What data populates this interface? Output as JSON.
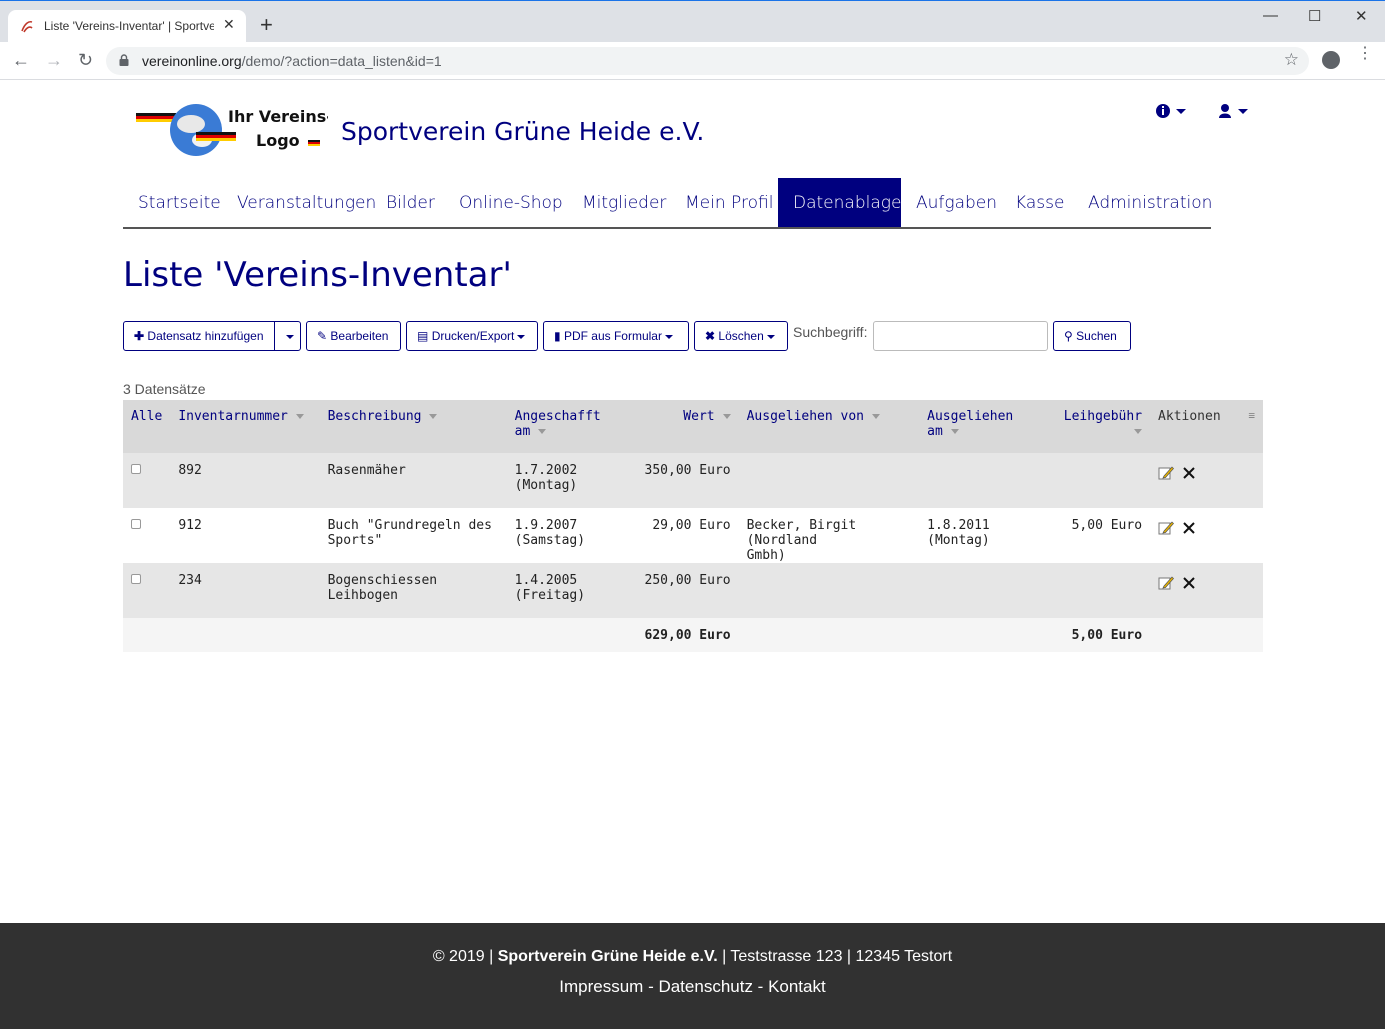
{
  "browser": {
    "tab_title": "Liste 'Vereins-Inventar' | Sportver",
    "new_tab": "+",
    "url_host": "vereinonline.org",
    "url_path": "/demo/?action=data_listen&id=1",
    "minimize": "—",
    "maximize": "☐",
    "close": "✕",
    "back": "←",
    "forward": "→",
    "reload": "↻",
    "bookmark": "☆",
    "menu": "⋮"
  },
  "header": {
    "logo_text_line1": "Ihr Vereins-",
    "logo_text_line2": "Logo",
    "site_title": "Sportverein Grüne Heide e.V."
  },
  "nav": {
    "items": [
      {
        "label": "Startseite"
      },
      {
        "label": "Veranstaltungen"
      },
      {
        "label": "Bilder"
      },
      {
        "label": "Online-Shop"
      },
      {
        "label": "Mitglieder"
      },
      {
        "label": "Mein Profil"
      },
      {
        "label": "Datenablage"
      },
      {
        "label": "Aufgaben"
      },
      {
        "label": "Kasse"
      },
      {
        "label": "Administration"
      }
    ],
    "active": "Datenablage"
  },
  "page": {
    "title": "Liste 'Vereins-Inventar'"
  },
  "toolbar": {
    "add_label": "Datensatz hinzufügen",
    "edit_label": "Bearbeiten",
    "print_label": "Drucken/Export",
    "pdf_label": "PDF aus Formular",
    "delete_label": "Löschen",
    "search_label": "Suchbegriff:",
    "search_value": "",
    "search_button": "Suchen"
  },
  "table": {
    "count": "3 Datensätze",
    "headers": {
      "all": "Alle",
      "inventarnummer": "Inventarnummer",
      "beschreibung": "Beschreibung",
      "angeschafft_1": "Angeschafft",
      "angeschafft_2": "am",
      "wert": "Wert",
      "ausgeliehen_von": "Ausgeliehen von",
      "ausgeliehen_am_1": "Ausgeliehen",
      "ausgeliehen_am_2": "am",
      "leihgebuehr": "Leihgebühr",
      "aktionen": "Aktionen"
    },
    "rows": [
      {
        "nr": "892",
        "desc_1": "Rasenmäher",
        "desc_2": "",
        "date_1": "1.7.2002",
        "date_2": "(Montag)",
        "wert": "350,00 Euro",
        "von_1": "",
        "von_2": "",
        "am_1": "",
        "am_2": "",
        "gebuehr": ""
      },
      {
        "nr": "912",
        "desc_1": "Buch \"Grundregeln des",
        "desc_2": "Sports\"",
        "date_1": "1.9.2007",
        "date_2": "(Samstag)",
        "wert": "29,00 Euro",
        "von_1": "Becker, Birgit (Nordland",
        "von_2": "Gmbh)",
        "am_1": "1.8.2011",
        "am_2": "(Montag)",
        "gebuehr": "5,00 Euro"
      },
      {
        "nr": "234",
        "desc_1": "Bogenschiessen",
        "desc_2": "Leihbogen",
        "date_1": "1.4.2005",
        "date_2": "(Freitag)",
        "wert": "250,00 Euro",
        "von_1": "",
        "von_2": "",
        "am_1": "",
        "am_2": "",
        "gebuehr": ""
      }
    ],
    "sum_wert": "629,00 Euro",
    "sum_gebuehr": "5,00 Euro"
  },
  "footer": {
    "copyright": "© 2019 |",
    "club": "Sportverein Grüne Heide e.V.",
    "address": "| Teststrasse 123 | 12345 Testort",
    "impressum": "Impressum",
    "sep": " - ",
    "datenschutz": "Datenschutz",
    "kontakt": "Kontakt"
  },
  "colors": {
    "brand": "#00007f",
    "footer_bg": "#313131",
    "row_odd": "#e6e6e6",
    "header_bg": "#d9d9d9"
  }
}
